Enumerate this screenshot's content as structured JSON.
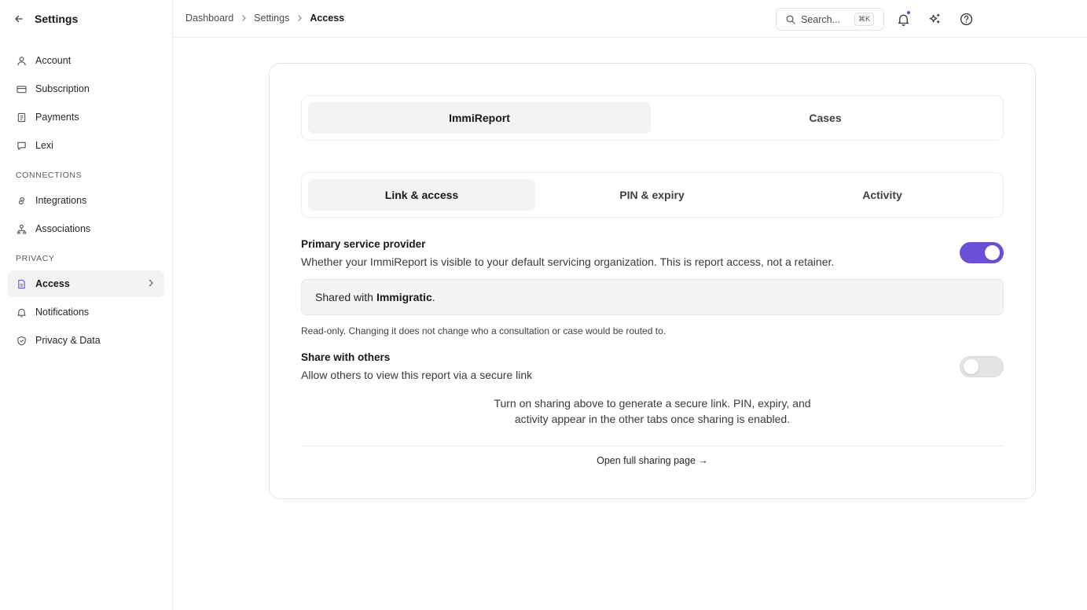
{
  "sidebar": {
    "title": "Settings",
    "items": [
      {
        "label": "Account",
        "icon": "user-icon"
      },
      {
        "label": "Subscription",
        "icon": "card-icon"
      },
      {
        "label": "Payments",
        "icon": "receipt-icon"
      },
      {
        "label": "Lexi",
        "icon": "chat-icon"
      },
      {
        "label": "Integrations",
        "icon": "link-icon"
      },
      {
        "label": "Associations",
        "icon": "network-icon"
      },
      {
        "label": "Access",
        "icon": "document-icon",
        "active": true
      },
      {
        "label": "Notifications",
        "icon": "bell-icon"
      },
      {
        "label": "Privacy & Data",
        "icon": "shield-icon"
      }
    ],
    "sections": {
      "connections": "CONNECTIONS",
      "privacy": "PRIVACY"
    }
  },
  "topbar": {
    "breadcrumbs": [
      "Dashboard",
      "Settings",
      "Access"
    ],
    "search_placeholder": "Search...",
    "search_shortcut": "⌘K",
    "has_notification": true
  },
  "main": {
    "top_tabs": [
      {
        "label": "ImmiReport",
        "selected": true
      },
      {
        "label": "Cases",
        "selected": false
      }
    ],
    "sub_tabs": [
      {
        "label": "Link & access",
        "selected": true
      },
      {
        "label": "PIN & expiry",
        "selected": false
      },
      {
        "label": "Activity",
        "selected": false
      }
    ],
    "primary": {
      "title": "Primary service provider",
      "description": "Whether your ImmiReport is visible to your default servicing organization. This is report access, not a retainer.",
      "enabled": true,
      "shared_prefix": "Shared with",
      "shared_org": "Immigratic",
      "shared_suffix": ".",
      "note": "Read-only. Changing it does not change who a consultation or case would be routed to."
    },
    "share": {
      "title": "Share with others",
      "description": "Allow others to view this report via a secure link",
      "enabled": false
    },
    "info_line1": "Turn on sharing above to generate a secure link. PIN, expiry, and",
    "info_line2": "activity appear in the other tabs once sharing is enabled.",
    "full_link": "Open full sharing page →"
  },
  "colors": {
    "accent": "#6b4fd8",
    "notification_dot": "#6b3ee6"
  }
}
